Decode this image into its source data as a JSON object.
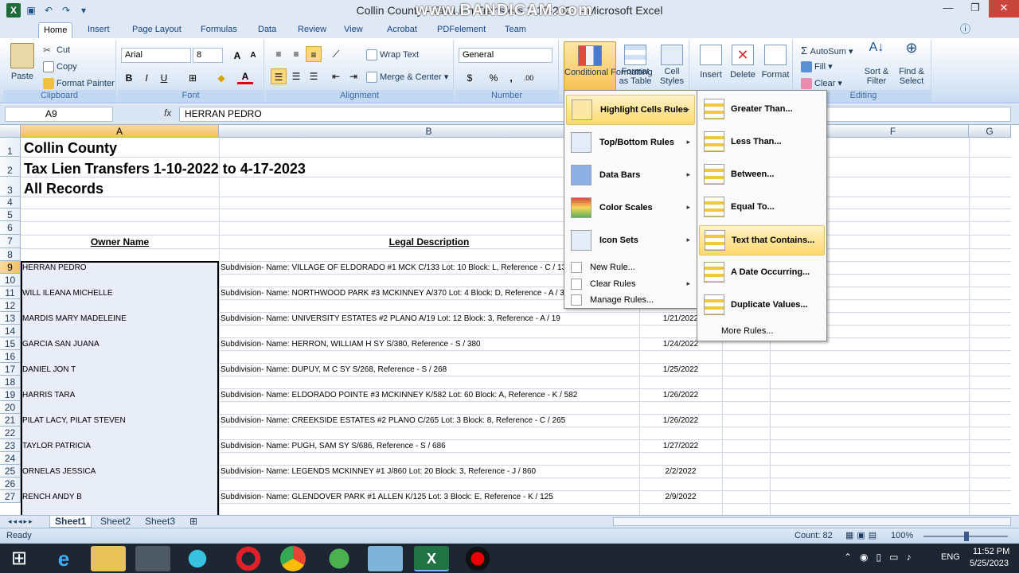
{
  "window": {
    "title": "Collin County - Tax Lien Transfers 1-10-2023 - Microsoft Excel",
    "watermark": "www.BANDICAM.com"
  },
  "tabs": [
    "Home",
    "Insert",
    "Page Layout",
    "Formulas",
    "Data",
    "Review",
    "View",
    "Acrobat",
    "PDFelement",
    "Team"
  ],
  "ribbon": {
    "clipboard": {
      "paste": "Paste",
      "cut": "Cut",
      "copy": "Copy",
      "format_painter": "Format Painter",
      "label": "Clipboard"
    },
    "font": {
      "name": "Arial",
      "size": "8",
      "label": "Font",
      "bold": "B",
      "italic": "I",
      "underline": "U",
      "font_color_letter": "A"
    },
    "alignment": {
      "wrap": "Wrap Text",
      "merge": "Merge & Center",
      "label": "Alignment"
    },
    "number": {
      "format": "General",
      "label": "Number",
      "currency": "$",
      "percent": "%",
      "comma": ","
    },
    "styles": {
      "conditional": "Conditional Formatting",
      "format_table": "Format as Table",
      "cell_styles": "Cell Styles"
    },
    "cells": {
      "insert": "Insert",
      "delete": "Delete",
      "format": "Format"
    },
    "editing": {
      "autosum": "AutoSum",
      "fill": "Fill",
      "clear": "Clear",
      "sort": "Sort & Filter",
      "find": "Find & Select",
      "label": "Editing"
    }
  },
  "formula_bar": {
    "name_box": "A9",
    "fx": "fx",
    "value": "HERRAN PEDRO"
  },
  "columns": [
    {
      "name": "A",
      "selected": true
    },
    {
      "name": "B",
      "selected": false
    },
    {
      "name": "F",
      "selected": false
    },
    {
      "name": "G",
      "selected": false
    }
  ],
  "rows": [
    "1",
    "2",
    "3",
    "4",
    "5",
    "6",
    "7",
    "8",
    "9",
    "10",
    "11",
    "12",
    "13",
    "14",
    "15",
    "16",
    "17",
    "18",
    "19",
    "20",
    "21",
    "22",
    "23",
    "24",
    "25",
    "26",
    "27"
  ],
  "sheet": {
    "title1": "Collin County",
    "title2": "Tax Lien Transfers 1-10-2022 to 4-17-2023",
    "title3": "All Records",
    "header_owner": "Owner Name",
    "header_legal": "Legal Description",
    "records": [
      {
        "owner": "HERRAN PEDRO",
        "legal": "Subdivision-  Name: VILLAGE OF ELDORADO #1 MCK C/133 Lot: 10 Block: L, Reference - C / 133",
        "date": ""
      },
      {
        "owner": "WILL ILEANA MICHELLE",
        "legal": "Subdivision-  Name: NORTHWOOD PARK #3 MCKINNEY A/370 Lot: 4 Block: D, Reference - A / 370",
        "date": ""
      },
      {
        "owner": "MARDIS MARY MADELEINE",
        "legal": "Subdivision-  Name: UNIVERSITY ESTATES #2 PLANO A/19 Lot: 12 Block: 3, Reference - A / 19",
        "date": "1/21/2022"
      },
      {
        "owner": "GARCIA SAN JUANA",
        "legal": "Subdivision-  Name: HERRON, WILLIAM H SY S/380, Reference - S / 380",
        "date": "1/24/2022"
      },
      {
        "owner": "DANIEL JON T",
        "legal": "Subdivision-  Name: DUPUY, M C SY S/268, Reference - S / 268",
        "date": "1/25/2022"
      },
      {
        "owner": "HARRIS TARA",
        "legal": "Subdivision-  Name: ELDORADO POINTE #3 MCKINNEY K/582 Lot: 60 Block: A, Reference - K / 582",
        "date": "1/26/2022"
      },
      {
        "owner": "PILAT LACY, PILAT STEVEN",
        "legal": "Subdivision-  Name: CREEKSIDE ESTATES #2 PLANO C/265 Lot: 3 Block: 8, Reference - C / 265",
        "date": "1/26/2022"
      },
      {
        "owner": "TAYLOR PATRICIA",
        "legal": "Subdivision-  Name: PUGH, SAM SY S/686, Reference - S / 686",
        "date": "1/27/2022"
      },
      {
        "owner": "ORNELAS JESSICA",
        "legal": "Subdivision-  Name: LEGENDS MCKINNEY #1 J/860 Lot: 20 Block: 3, Reference - J / 860",
        "date": "2/2/2022"
      },
      {
        "owner": "RENCH ANDY B",
        "legal": "Subdivision-  Name: GLENDOVER PARK #1 ALLEN K/125 Lot: 3 Block: E, Reference - K / 125",
        "date": "2/9/2022"
      }
    ]
  },
  "cf_menu": [
    {
      "label": "Highlight Cells Rules",
      "sub": true,
      "highlight": true
    },
    {
      "label": "Top/Bottom Rules",
      "sub": true
    },
    {
      "label": "Data Bars",
      "sub": true
    },
    {
      "label": "Color Scales",
      "sub": true
    },
    {
      "label": "Icon Sets",
      "sub": true
    },
    {
      "label": "New Rule...",
      "small": true
    },
    {
      "label": "Clear Rules",
      "small": true,
      "sub": true
    },
    {
      "label": "Manage Rules...",
      "small": true
    }
  ],
  "highlight_submenu": [
    {
      "label": "Greater Than..."
    },
    {
      "label": "Less Than..."
    },
    {
      "label": "Between..."
    },
    {
      "label": "Equal To..."
    },
    {
      "label": "Text that Contains...",
      "highlight": true
    },
    {
      "label": "A Date Occurring..."
    },
    {
      "label": "Duplicate Values..."
    },
    {
      "label": "More Rules...",
      "small": true
    }
  ],
  "sheet_tabs": [
    "Sheet1",
    "Sheet2",
    "Sheet3"
  ],
  "status": {
    "ready": "Ready",
    "count": "Count: 82",
    "zoom": "100%"
  },
  "taskbar": {
    "lang": "ENG",
    "time": "11:52 PM",
    "date": "5/25/2023"
  },
  "colors": {
    "accent": "#fdd86e",
    "ribbon": "#dbe8f7",
    "selection": "#f1c15f"
  }
}
